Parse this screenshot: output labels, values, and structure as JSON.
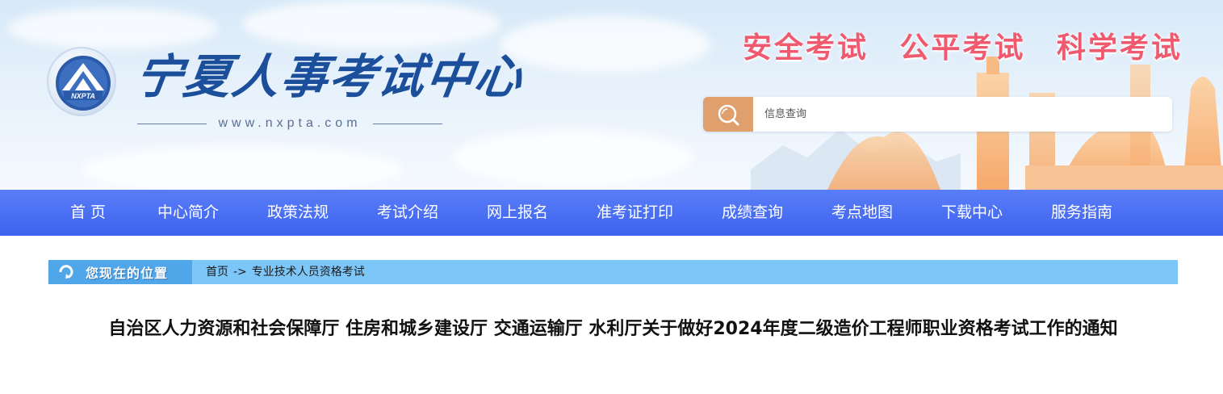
{
  "header": {
    "site_name": "宁夏人事考试中心",
    "emblem_text": "NXPTA",
    "url": "www.nxpta.com",
    "slogans": [
      "安全考试",
      "公平考试",
      "科学考试"
    ],
    "search": {
      "placeholder": "信息查询"
    }
  },
  "nav": {
    "items": [
      {
        "label": "首 页"
      },
      {
        "label": "中心简介"
      },
      {
        "label": "政策法规"
      },
      {
        "label": "考试介绍"
      },
      {
        "label": "网上报名"
      },
      {
        "label": "准考证打印"
      },
      {
        "label": "成绩查询"
      },
      {
        "label": "考点地图"
      },
      {
        "label": "下载中心"
      },
      {
        "label": "服务指南"
      }
    ]
  },
  "breadcrumb": {
    "label": "您现在的位置",
    "home": "首页",
    "separator": "->",
    "current": "专业技术人员资格考试"
  },
  "article": {
    "title": "自治区人力资源和社会保障厅 住房和城乡建设厅 交通运输厅 水利厅关于做好2024年度二级造价工程师职业资格考试工作的通知"
  },
  "colors": {
    "nav_bg": "#4a6ff2",
    "slogan": "#f05a6e",
    "search_button": "#e0a06e",
    "breadcrumb_bg": "#7dc7f8",
    "site_name": "#1b4f9b"
  }
}
